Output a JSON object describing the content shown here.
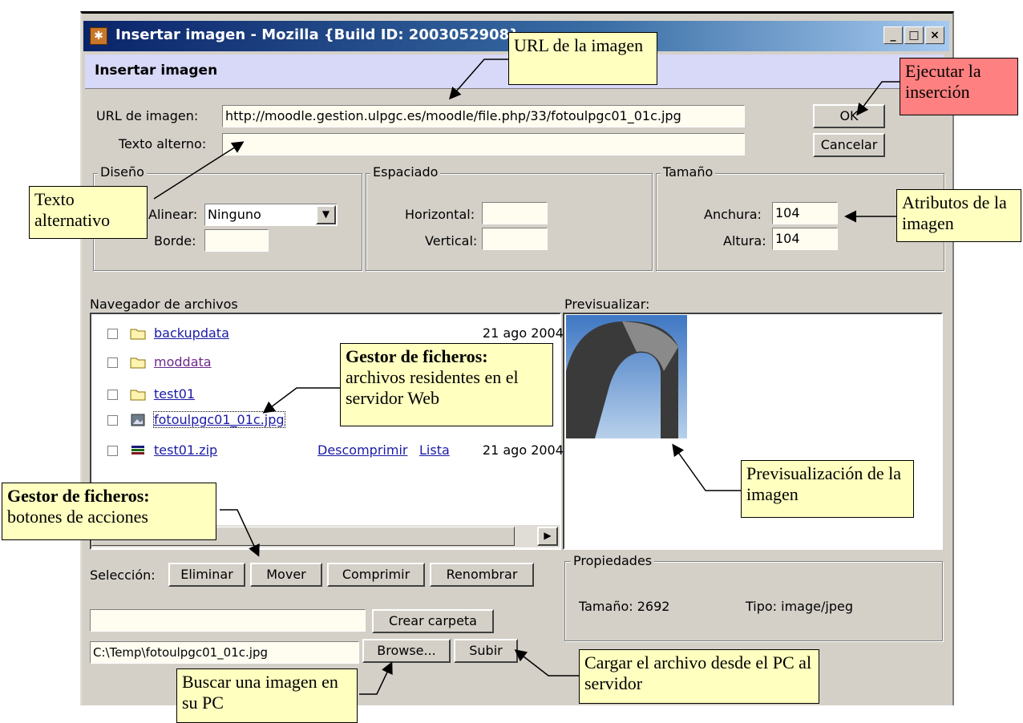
{
  "window": {
    "title": "Insertar imagen - Mozilla {Build ID: 2003052908}",
    "minimize": "_",
    "maximize": "□",
    "close": "×"
  },
  "dialog": {
    "header": "Insertar imagen",
    "url_label": "URL de imagen:",
    "url_value": "http://moodle.gestion.ulpgc.es/moodle/file.php/33/fotoulpgc01_01c.jpg",
    "alt_label": "Texto alterno:",
    "alt_value": "",
    "ok_button": "OK",
    "cancel_button": "Cancelar"
  },
  "design": {
    "title": "Diseño",
    "align_label": "Alinear:",
    "align_value": "Ninguno",
    "border_label": "Borde:",
    "border_value": ""
  },
  "spacing": {
    "title": "Espaciado",
    "horizontal_label": "Horizontal:",
    "horizontal_value": "",
    "vertical_label": "Vertical:",
    "vertical_value": ""
  },
  "size": {
    "title": "Tamaño",
    "width_label": "Anchura:",
    "width_value": "104",
    "height_label": "Altura:",
    "height_value": "104"
  },
  "browser": {
    "title": "Navegador de archivos",
    "files": [
      {
        "name": "backupdata",
        "type": "folder",
        "date": "21 ago 2004,"
      },
      {
        "name": "moddata",
        "type": "folder",
        "date": ","
      },
      {
        "name": "test01",
        "type": "folder",
        "date": ","
      },
      {
        "name": "fotoulpgc01_01c.jpg",
        "type": "image",
        "date": ","
      },
      {
        "name": "test01.zip",
        "type": "zip",
        "actions": [
          "Descomprimir",
          "Lista"
        ],
        "date": "21 ago 2004,"
      }
    ]
  },
  "preview": {
    "title": "Previsualizar:"
  },
  "actions": {
    "selection_label": "Selección:",
    "delete_button": "Eliminar",
    "move_button": "Mover",
    "compress_button": "Comprimir",
    "rename_button": "Renombrar",
    "folder_value": "",
    "create_folder_button": "Crear carpeta",
    "upload_path": "C:\\Temp\\fotoulpgc01_01c.jpg",
    "browse_button": "Browse...",
    "upload_button": "Subir"
  },
  "properties": {
    "title": "Propiedades",
    "size_text": "Tamaño: 2692",
    "type_text": "Tipo: image/jpeg"
  },
  "callouts": {
    "url": "URL de la imagen",
    "execute": "Ejecutar la inserción",
    "alt_text": "Texto alternativo",
    "attrs": "Atributos de la imagen",
    "file_manager_1_bold": "Gestor de ficheros:",
    "file_manager_1_rest": "archivos residentes en el servidor Web",
    "file_manager_2_bold": "Gestor de ficheros:",
    "file_manager_2_rest": "botones de acciones",
    "preview": "Previsualización de la imagen",
    "load": "Cargar el archivo desde el PC al servidor",
    "search": "Buscar una imagen en su PC"
  },
  "colors": {
    "callout_bg": "#ffffc0",
    "callout_highlight": "#ff8080",
    "header_bg": "#d8d8f8",
    "link": "#1a1aa6"
  }
}
